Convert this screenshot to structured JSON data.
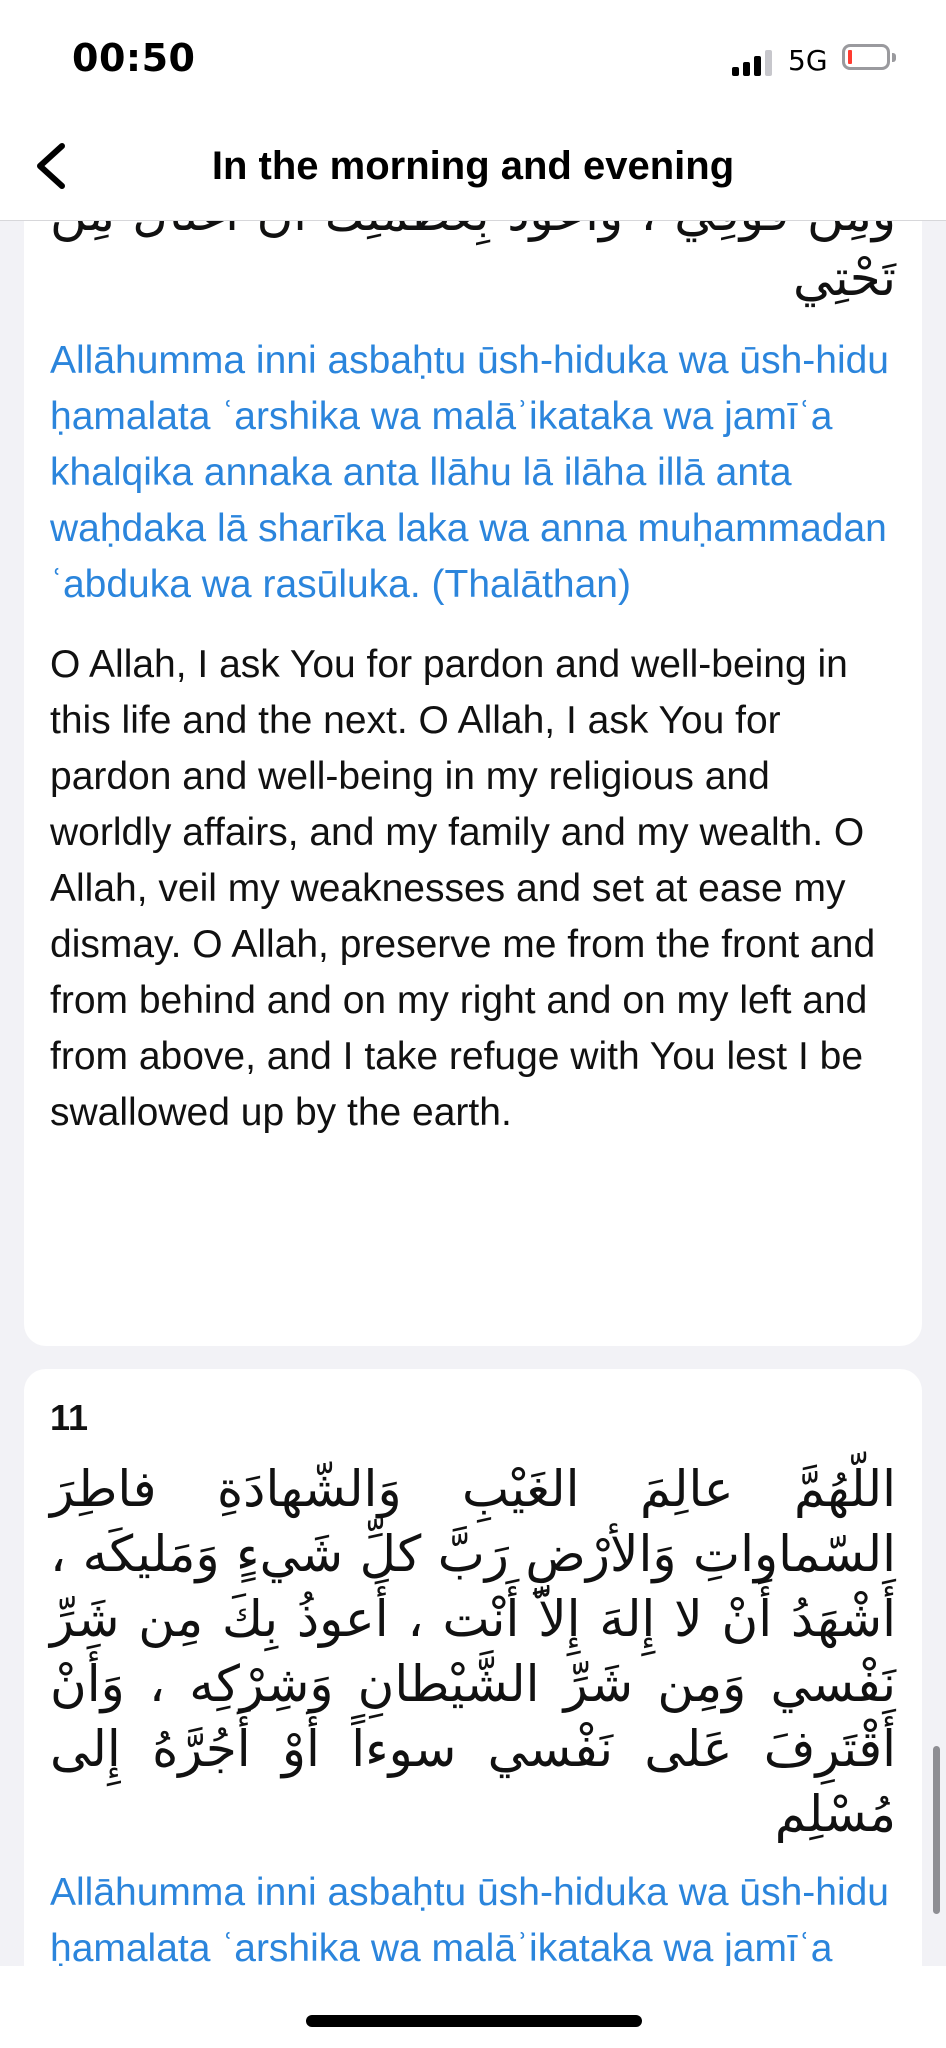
{
  "status_bar": {
    "time": "00:50",
    "network": "5G"
  },
  "nav": {
    "title": "In the morning and evening"
  },
  "cards": [
    {
      "arabic": "وَمِن فَوْقِي ، وَأَعوذُ بِعَظَمَتِكَ أَن أُغتالَ مِن تَحْتِي",
      "transliteration": "Allāhumma inni asbaḥtu ūsh-hiduka wa ūsh-hidu ḥamalata ʿarshika wa malāʾikataka wa jamīʿa khalqika annaka anta llāhu lā ilāha illā anta waḥdaka lā sharīka laka wa anna muḥammadan ʿabduka wa rasūluka. (Thalāthan)",
      "translation": "O Allah, I ask You for pardon and well-being in this life and the next. O Allah, I ask You for pardon and well-being in my religious and worldly affairs, and my family and my wealth. O Allah, veil my weaknesses and set at ease my dismay. O Allah, preserve me from the front and from behind and on my right and on my left and from above, and I take refuge with You lest I be swallowed up by the earth."
    },
    {
      "number": "11",
      "arabic": "اللّهُمَّ عالِمَ الغَيْبِ وَالشّهادَةِ فاطِرَ السّماواتِ وَالأرْضِ رَبَّ كلِّ شَيءٍ وَمَليكَه ، أَشْهَدُ أَنْ لا إِلهَ إِلاّ أَنْت ، أَعوذُ بِكَ مِن شَرِّ نَفْسي وَمِن شَرِّ الشَّيْطانِ وَشِرْكِه ، وَأَنْ أَقْتَرِفَ عَلى نَفْسي سوءاً أَوْ أَجُرَّهُ إِلى مُسْلِم",
      "transliteration": "Allāhumma inni asbaḥtu ūsh-hiduka wa ūsh-hidu ḥamalata ʿarshika wa malāʾikataka wa jamīʿa khalqika annaka anta llāhu lā"
    }
  ],
  "colors": {
    "transliteration": "#2b85dc",
    "background": "#f2f2f6",
    "card": "#ffffff"
  },
  "icons": {
    "back": "chevron-left-icon"
  }
}
